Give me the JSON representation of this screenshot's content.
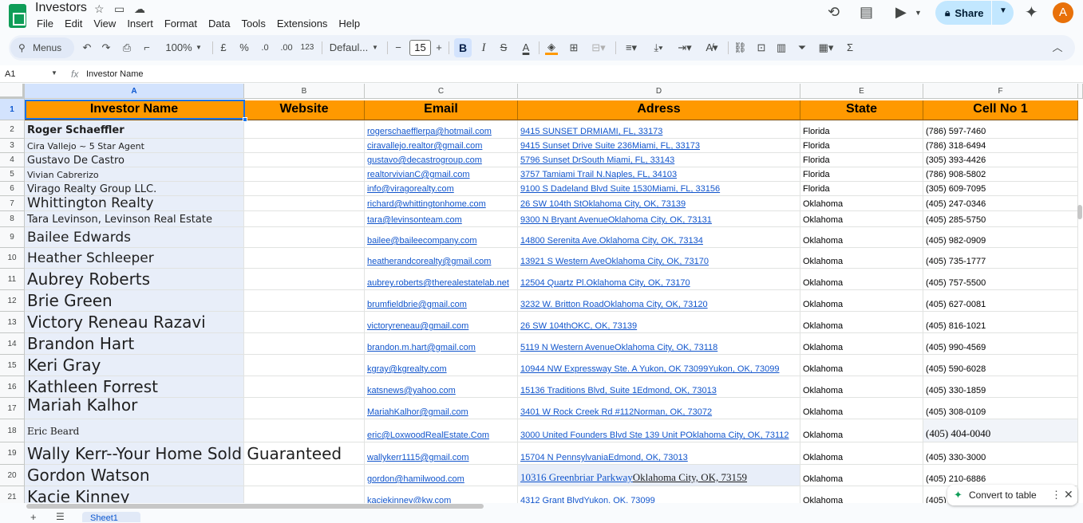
{
  "document": {
    "title": "Investors",
    "menus": [
      "File",
      "Edit",
      "View",
      "Insert",
      "Format",
      "Data",
      "Tools",
      "Extensions",
      "Help"
    ]
  },
  "share": {
    "label": "Share"
  },
  "user": {
    "avatar_letter": "A",
    "avatar_color": "#e8710a"
  },
  "toolbar": {
    "search_label": "Menus",
    "zoom": "100%",
    "currency": "£",
    "percent": "%",
    "decrease_decimal": ".0",
    "increase_decimal": ".00",
    "number_format": "123",
    "font": "Defaul...",
    "font_size": "15",
    "bold": "B",
    "italic": "I",
    "text_color_letter": "A",
    "text_color_bar": "#000000",
    "fill_color_bar": "#ff9900"
  },
  "formula_bar": {
    "cell_ref": "A1",
    "fx": "fx",
    "value": "Investor Name"
  },
  "columns": [
    "A",
    "B",
    "C",
    "D",
    "E",
    "F"
  ],
  "header_row": {
    "number": "1",
    "cells": [
      "Investor Name",
      "Website",
      "Email",
      "Adress",
      "State",
      "Cell No 1"
    ]
  },
  "rows": [
    {
      "n": "2",
      "name": "Roger Schaeffler",
      "email": "rogerschaefflerpa@hotmail.com",
      "address": "9415 SUNSET DRMIAMI, FL, 33173",
      "state": "Florida",
      "phone": "(786) 597-7460"
    },
    {
      "n": "3",
      "name": "Cira Vallejo ~ 5 Star Agent",
      "email": "ciravallejo.realtor@gmail.com",
      "address": "9415 Sunset Drive Suite 236Miami, FL, 33173",
      "state": "Florida",
      "phone": "(786) 318-6494"
    },
    {
      "n": "4",
      "name": "Gustavo De Castro",
      "email": "gustavo@decastrogroup.com",
      "address": "5796 Sunset DrSouth Miami, FL, 33143",
      "state": "Florida",
      "phone": "(305) 393-4426"
    },
    {
      "n": "5",
      "name": "Vivian Cabrerizo",
      "email": "realtorvivianC@gmail.com",
      "address": "3757 Tamiami Trail N.Naples, FL, 34103",
      "state": "Florida",
      "phone": "(786) 908-5802"
    },
    {
      "n": "6",
      "name": "Virago Realty Group LLC.",
      "email": "info@viragorealty.com",
      "address": "9100 S Dadeland Blvd Suite 1530Miami, FL, 33156",
      "state": "Florida",
      "phone": "(305) 609-7095"
    },
    {
      "n": "7",
      "name": "Whittington Realty",
      "email": "richard@whittingtonhome.com",
      "address": "26 SW 104th StOklahoma City, OK, 73139",
      "state": "Oklahoma",
      "phone": "(405) 247-0346"
    },
    {
      "n": "8",
      "name": "Tara Levinson, Levinson Real Estate",
      "email": "tara@levinsonteam.com",
      "address": "9300 N Bryant AvenueOklahoma City, OK, 73131",
      "state": "Oklahoma",
      "phone": "(405) 285-5750"
    },
    {
      "n": "9",
      "name": "Bailee Edwards",
      "email": "bailee@baileecompany.com",
      "address": "14800 Serenita Ave.Oklahoma City, OK, 73134",
      "state": "Oklahoma",
      "phone": "(405) 982-0909"
    },
    {
      "n": "10",
      "name": "Heather Schleeper",
      "email": "heatherandcorealty@gmail.com",
      "address": "13921 S Western AveOklahoma City, OK, 73170",
      "state": "Oklahoma",
      "phone": "(405) 735-1777"
    },
    {
      "n": "11",
      "name": "Aubrey Roberts",
      "email": "aubrey.roberts@therealestatelab.net",
      "address": "12504 Quartz Pl.Oklahoma City, OK, 73170",
      "state": "Oklahoma",
      "phone": "(405) 757-5500"
    },
    {
      "n": "12",
      "name": "Brie Green",
      "email": "brumfieldbrie@gmail.com",
      "address": "3232 W. Britton RoadOklahoma City, OK, 73120",
      "state": "Oklahoma",
      "phone": "(405) 627-0081"
    },
    {
      "n": "13",
      "name": "Victory Reneau Razavi",
      "email": "victoryreneau@gmail.com",
      "address": "26 SW 104thOKC, OK, 73139",
      "state": "Oklahoma",
      "phone": "(405) 816-1021"
    },
    {
      "n": "14",
      "name": "Brandon Hart",
      "email": "brandon.m.hart@gmail.com",
      "address": "5119 N Western AvenueOklahoma City, OK, 73118",
      "state": "Oklahoma",
      "phone": "(405) 990-4569"
    },
    {
      "n": "15",
      "name": "Keri Gray",
      "email": "kgray@kgrealty.com",
      "address": "10944 NW Expressway Ste. A Yukon, OK 73099Yukon, OK, 73099",
      "state": "Oklahoma",
      "phone": "(405) 590-6028"
    },
    {
      "n": "16",
      "name": "Kathleen Forrest",
      "email": "katsnews@yahoo.com",
      "address": "15136 Traditions Blvd, Suite 1Edmond, OK, 73013",
      "state": "Oklahoma",
      "phone": "(405) 330-1859"
    },
    {
      "n": "17",
      "name": "Mariah Kalhor",
      "email": "MariahKalhor@gmail.com",
      "address": "3401 W Rock Creek Rd #112Norman, OK, 73072",
      "state": "Oklahoma",
      "phone": "(405) 308-0109"
    },
    {
      "n": "18",
      "name": "Eric Beard",
      "email": "eric@LoxwoodRealEstate.Com",
      "address": "3000 United Founders Blvd Ste 139 Unit POklahoma City, OK, 73112",
      "state": "Oklahoma",
      "phone": "(405) 404-0040"
    },
    {
      "n": "19",
      "name": "Wally Kerr--Your Home Sold Guaranteed",
      "email": "wallykerr1115@gmail.com",
      "address": "15704 N PennsylvaniaEdmond, OK, 73013",
      "state": "Oklahoma",
      "phone": "(405) 330-3000"
    },
    {
      "n": "20",
      "name": "Gordon Watson",
      "email": "gordon@hamilwood.com",
      "address_link": "10316 Greenbriar Parkway",
      "address_rest": "Oklahoma City, OK, 73159",
      "state": "Oklahoma",
      "phone": "(405) 210-6886"
    },
    {
      "n": "21",
      "name": "Kacie Kinney",
      "email": "kaciekinney@kw.com",
      "address": "4312 Grant BlvdYukon, OK, 73099",
      "state": "Oklahoma",
      "phone": "(405)"
    }
  ],
  "convert_chip": {
    "label": "Convert to table"
  },
  "sheet_tab": {
    "label": "Sheet1"
  }
}
